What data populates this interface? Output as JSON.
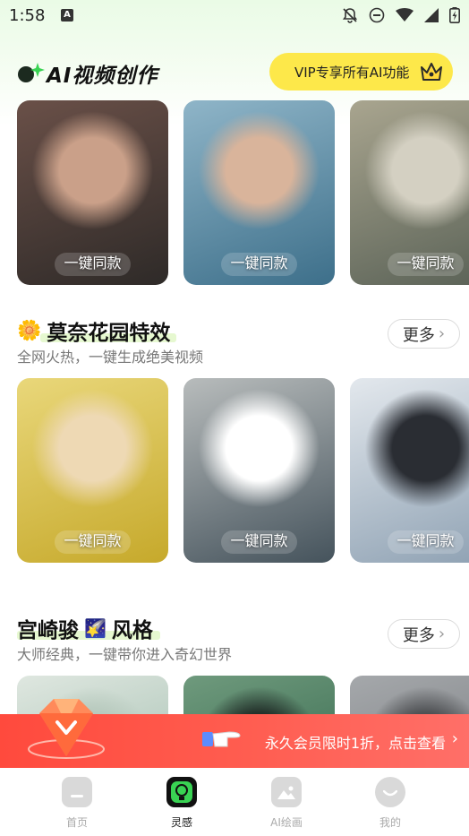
{
  "status_bar": {
    "time": "1:58",
    "a_badge": "A"
  },
  "header": {
    "title": "AI视频创作",
    "vip_label": "VIP专享所有AI功能"
  },
  "rows": [
    {
      "cards": [
        {
          "label": "一键同款",
          "palette": [
            "#2e2a28",
            "#6a5048",
            "#caa089"
          ]
        },
        {
          "label": "一键同款",
          "palette": [
            "#3d6f8a",
            "#8fb5c8",
            "#d9b49b"
          ]
        },
        {
          "label": "一键同款",
          "palette": [
            "#596156",
            "#a9a58f",
            "#d4d0c2"
          ]
        }
      ]
    },
    {
      "cards": [
        {
          "label": "一键同款",
          "palette": [
            "#c6a92b",
            "#e9d77a",
            "#eed9b4"
          ]
        },
        {
          "label": "一键同款",
          "palette": [
            "#45535c",
            "#b8bcbc",
            "#ffffff"
          ]
        },
        {
          "label": "一键同款",
          "palette": [
            "#8da0b2",
            "#e3e8ed",
            "#2a2d33"
          ]
        }
      ]
    },
    {
      "cards": [
        {
          "label": "",
          "palette": [
            "#8fb1a0",
            "#dfe7e0",
            "#b7c9bd"
          ]
        },
        {
          "label": "",
          "palette": [
            "#24593f",
            "#6f9a7d",
            "#23302a"
          ]
        },
        {
          "label": "",
          "palette": [
            "#6b6e72",
            "#a5a8ab",
            "#4e5053"
          ]
        }
      ]
    }
  ],
  "sections": [
    {
      "emoji": "🌼",
      "title": "莫奈花园特效",
      "subtitle": "全网火热，一键生成绝美视频",
      "more": "更多"
    },
    {
      "title_before": "宫崎骏",
      "emoji": "🌠",
      "title_after": "风格",
      "subtitle": "大师经典，一键带你进入奇幻世界",
      "more": "更多"
    }
  ],
  "promo": {
    "text": "永久会员限时1折，点击查看",
    "chevron": "›"
  },
  "nav": [
    {
      "label": "首页",
      "icon": "home-icon",
      "active": false
    },
    {
      "label": "灵感",
      "icon": "lightbulb-icon",
      "active": true
    },
    {
      "label": "AI绘画",
      "icon": "picture-icon",
      "active": false
    },
    {
      "label": "我的",
      "icon": "profile-icon",
      "active": false
    }
  ],
  "colors": {
    "accent_green": "#39d353",
    "vip_yellow": "#fde84a",
    "promo_red": "#ff4a3d"
  }
}
